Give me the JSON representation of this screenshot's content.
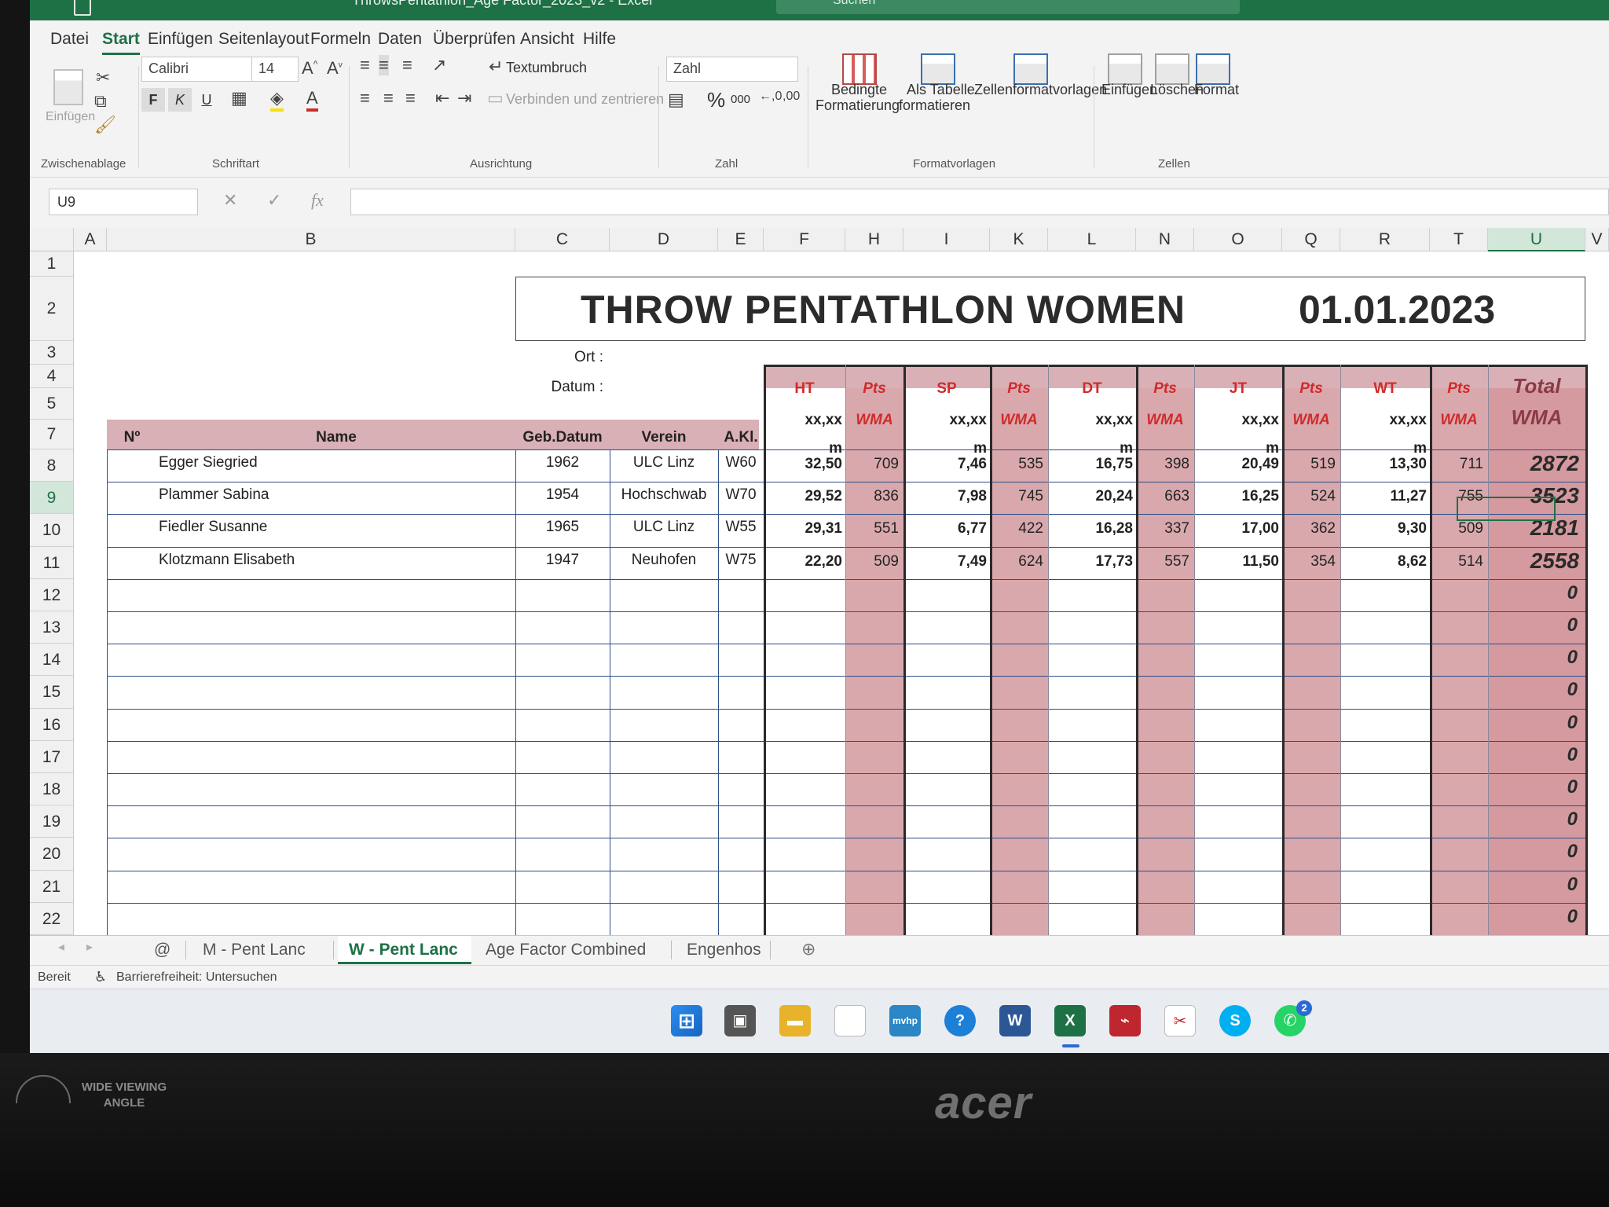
{
  "window": {
    "title": "ThrowsPentathlon_Age Factor_2023_v2  -  Excel",
    "search_placeholder": "Suchen"
  },
  "menu": [
    "Datei",
    "Start",
    "Einfügen",
    "Seitenlayout",
    "Formeln",
    "Daten",
    "Überprüfen",
    "Ansicht",
    "Hilfe"
  ],
  "ribbon": {
    "clipboard": {
      "paste": "Einfügen",
      "label": "Zwischenablage"
    },
    "font": {
      "name": "Calibri",
      "size": "14",
      "bold": "F",
      "italic": "K",
      "underline": "U",
      "label": "Schriftart"
    },
    "alignment": {
      "wrap": "Textumbruch",
      "merge": "Verbinden und zentrieren",
      "label": "Ausrichtung"
    },
    "number": {
      "format": "Zahl",
      "percent": "%",
      "thousands": "000",
      "label": "Zahl"
    },
    "styles": {
      "conditional": "Bedingte",
      "conditional2": "Formatierung",
      "table": "Als Tabelle",
      "table2": "formatieren",
      "cell": "Zellenformatvorlagen",
      "label": "Formatvorlagen"
    },
    "cells": {
      "insert": "Einfügen",
      "delete": "Löschen",
      "format": "Format",
      "label": "Zellen"
    }
  },
  "formula_bar": {
    "name_box": "U9",
    "fx": "fx",
    "content": ""
  },
  "columns": [
    "A",
    "B",
    "C",
    "D",
    "E",
    "F",
    "H",
    "I",
    "K",
    "L",
    "N",
    "O",
    "Q",
    "R",
    "T",
    "U",
    "V"
  ],
  "rows": [
    "1",
    "2",
    "3",
    "4",
    "5",
    "7",
    "8",
    "9",
    "10",
    "11",
    "12",
    "13",
    "14",
    "15",
    "16",
    "17",
    "18",
    "19",
    "20",
    "21",
    "22"
  ],
  "sheet": {
    "title": "THROW PENTATHLON WOMEN",
    "date": "01.01.2023",
    "ort_label": "Ort :",
    "datum_label": "Datum :",
    "headers": {
      "nr": "Nº",
      "name": "Name",
      "geb": "Geb.Datum",
      "verein": "Verein",
      "akl": "A.Kl."
    },
    "events": [
      {
        "code": "HT",
        "pts": "Pts",
        "fmt": "xx,xx",
        "wma": "WMA",
        "unit": "m"
      },
      {
        "code": "SP",
        "pts": "Pts",
        "fmt": "xx,xx",
        "wma": "WMA",
        "unit": "m"
      },
      {
        "code": "DT",
        "pts": "Pts",
        "fmt": "xx,xx",
        "wma": "WMA",
        "unit": "m"
      },
      {
        "code": "JT",
        "pts": "Pts",
        "fmt": "xx,xx",
        "wma": "WMA",
        "unit": "m"
      },
      {
        "code": "WT",
        "pts": "Pts",
        "fmt": "xx,xx",
        "wma": "WMA",
        "unit": "m"
      }
    ],
    "total": {
      "line1": "Total",
      "line2": "WMA"
    },
    "athletes": [
      {
        "name": "Egger Siegried",
        "geb": "1962",
        "verein": "ULC Linz",
        "akl": "W60",
        "ht": "32,50",
        "ht_pts": "709",
        "sp": "7,46",
        "sp_pts": "535",
        "dt": "16,75",
        "dt_pts": "398",
        "jt": "20,49",
        "jt_pts": "519",
        "wt": "13,30",
        "wt_pts": "711",
        "total": "2872"
      },
      {
        "name": "Plammer Sabina",
        "geb": "1954",
        "verein": "Hochschwab",
        "akl": "W70",
        "ht": "29,52",
        "ht_pts": "836",
        "sp": "7,98",
        "sp_pts": "745",
        "dt": "20,24",
        "dt_pts": "663",
        "jt": "16,25",
        "jt_pts": "524",
        "wt": "11,27",
        "wt_pts": "755",
        "total": "3523"
      },
      {
        "name": "Fiedler Susanne",
        "geb": "1965",
        "verein": "ULC Linz",
        "akl": "W55",
        "ht": "29,31",
        "ht_pts": "551",
        "sp": "6,77",
        "sp_pts": "422",
        "dt": "16,28",
        "dt_pts": "337",
        "jt": "17,00",
        "jt_pts": "362",
        "wt": "9,30",
        "wt_pts": "509",
        "total": "2181"
      },
      {
        "name": "Klotzmann Elisabeth",
        "geb": "1947",
        "verein": "Neuhofen",
        "akl": "W75",
        "ht": "22,20",
        "ht_pts": "509",
        "sp": "7,49",
        "sp_pts": "624",
        "dt": "17,73",
        "dt_pts": "557",
        "jt": "11,50",
        "jt_pts": "354",
        "wt": "8,62",
        "wt_pts": "514",
        "total": "2558"
      }
    ],
    "empty_totals": [
      "0",
      "0",
      "0",
      "0",
      "0",
      "0",
      "0",
      "0",
      "0",
      "0",
      "0"
    ]
  },
  "tabs": [
    "@",
    "M - Pent Lanc",
    "W - Pent Lanc",
    "Age Factor Combined",
    "Engenhos"
  ],
  "active_tab": "W - Pent Lanc",
  "status": {
    "ready": "Bereit",
    "accessibility": "Barrierefreiheit: Untersuchen"
  },
  "taskbar": {
    "whatsapp_badge": "2"
  },
  "monitor": {
    "brand": "acer",
    "sticker_line1": "WIDE VIEWING",
    "sticker_line2": "ANGLE"
  }
}
